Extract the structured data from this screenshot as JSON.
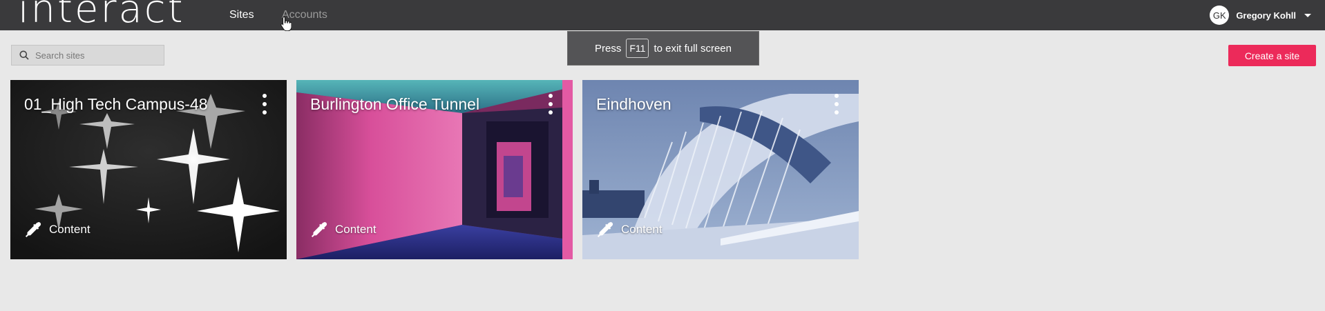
{
  "header": {
    "logo": "interact",
    "nav": [
      {
        "label": "Sites"
      },
      {
        "label": "Accounts"
      }
    ],
    "user": {
      "initials": "GK",
      "name": "Gregory Kohll"
    }
  },
  "search": {
    "placeholder": "Search sites",
    "icon": "search-icon"
  },
  "fullscreen_toast": {
    "before": "Press",
    "key": "F11",
    "after": "to exit full screen"
  },
  "actions": {
    "create_site": "Create a site",
    "accent_color": "#ec2a5a"
  },
  "sites": [
    {
      "title": "01_High Tech Campus-48",
      "content_label": "Content",
      "image": "sparkles"
    },
    {
      "title": "Burlington Office Tunnel",
      "content_label": "Content",
      "image": "pink-tunnel"
    },
    {
      "title": "Eindhoven",
      "content_label": "Content",
      "image": "bridge"
    }
  ]
}
